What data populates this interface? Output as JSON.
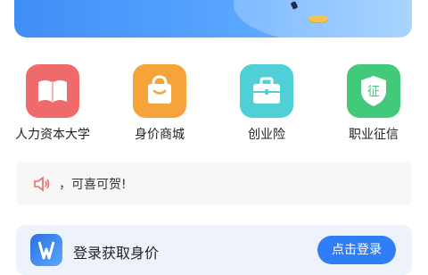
{
  "services": [
    {
      "label": "人力资本大学",
      "icon": "book-icon",
      "color": "#ee6a6a"
    },
    {
      "label": "身价商城",
      "icon": "shopping-bag-icon",
      "color": "#f5a43a"
    },
    {
      "label": "创业险",
      "icon": "briefcase-icon",
      "color": "#4fd0d6"
    },
    {
      "label": "职业征信",
      "icon": "shield-icon",
      "color": "#43c97a"
    }
  ],
  "notice": {
    "text": "，可喜可贺!"
  },
  "login": {
    "text": "登录获取身价",
    "button": "点击登录"
  },
  "colors": {
    "accent": "#2f7ef5",
    "banner": "#4a9aff"
  }
}
